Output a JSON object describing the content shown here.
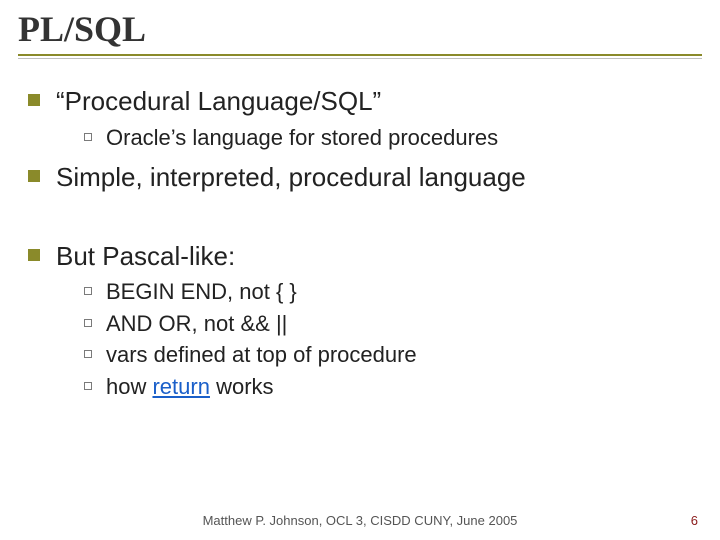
{
  "title": "PL/SQL",
  "bullets": {
    "b1": "“Procedural Language/SQL”",
    "b1_sub1": "Oracle’s language for stored procedures",
    "b2": "Simple, interpreted, procedural language",
    "b3": "But Pascal-like:",
    "b3_sub1": "BEGIN END, not { }",
    "b3_sub2": "AND OR, not && ||",
    "b3_sub3": "vars defined at top of procedure",
    "b3_sub4_pre": "how ",
    "b3_sub4_link": "return",
    "b3_sub4_post": " works"
  },
  "footer": "Matthew P. Johnson, OCL 3, CISDD CUNY, June 2005",
  "page": "6"
}
